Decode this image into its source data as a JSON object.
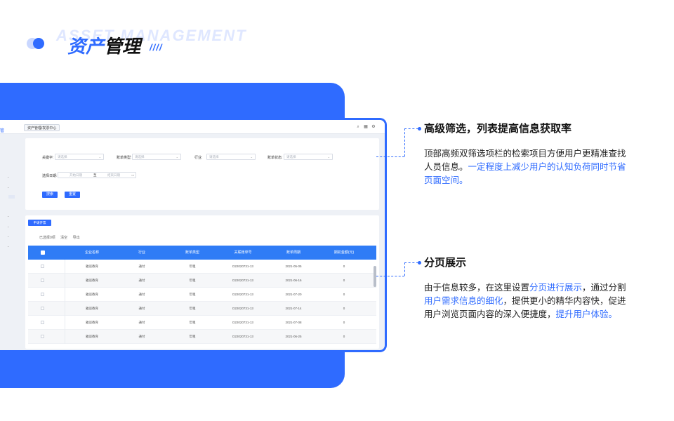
{
  "header": {
    "bg_text": "ASSET MANAGEMENT",
    "title_part1": "资产",
    "title_part2": "管理",
    "slashes": "////"
  },
  "app": {
    "breadcrumb": "资产管理/发票中心",
    "side_nav_label": "管",
    "filters": {
      "keyword_label": "关键字:",
      "keyword_placeholder": "请选择",
      "bill_type_label": "账单类型:",
      "bill_type_placeholder": "请选择",
      "industry_label": "行业:",
      "industry_placeholder": "请选择",
      "bill_status_label": "账单状态:",
      "bill_status_placeholder": "请选择",
      "date_label": "选择日期:",
      "date_start": "开始日期",
      "date_to": "至",
      "date_end": "结束日期",
      "search_btn": "搜索",
      "reset_btn": "重置"
    },
    "table": {
      "apply_btn": "申请开票",
      "selected_info": "已选择0项",
      "clear": "清空",
      "export": "导出",
      "columns": [
        "企业名称",
        "行业",
        "账单类型",
        "关联账单号",
        "账单周期",
        "期初金额(元)"
      ],
      "rows": [
        [
          "雅谈教育",
          "通付",
          "年租",
          "D22020731-13",
          "2021-05-05",
          "0"
        ],
        [
          "雅谈教育",
          "通付",
          "年租",
          "D22020731-13",
          "2021-06-16",
          "0"
        ],
        [
          "雅谈教育",
          "通付",
          "年租",
          "D22020731-13",
          "2021-07-20",
          "0"
        ],
        [
          "雅谈教育",
          "通付",
          "年租",
          "D22020731-13",
          "2021-07-14",
          "0"
        ],
        [
          "雅谈教育",
          "通付",
          "年租",
          "D22020731-13",
          "2021-07-08",
          "0"
        ],
        [
          "雅谈教育",
          "通付",
          "年租",
          "D22020731-13",
          "2021-06-25",
          "0"
        ]
      ]
    }
  },
  "callouts": [
    {
      "title": "高级筛选，列表提高信息获取率",
      "body_plain": "顶部高频双筛选项栏的检索项目方便用户更精准查找人员信息。",
      "body_highlight": "一定程度上减少用户的认知负荷同时节省页面空间。"
    },
    {
      "title": "分页展示",
      "body_1": "由于信息较多，在这里设置",
      "body_hl_1": "分页进行展示",
      "body_2": "，通过分割",
      "body_hl_2": "用户需求信息的细化",
      "body_3": "，提供更小的精华内容快，促进用户浏览页面内容的深入便捷度，",
      "body_hl_3": "提升用户体验。"
    }
  ],
  "colors": {
    "accent": "#2f6bff",
    "table_header": "#2f7cf6"
  }
}
